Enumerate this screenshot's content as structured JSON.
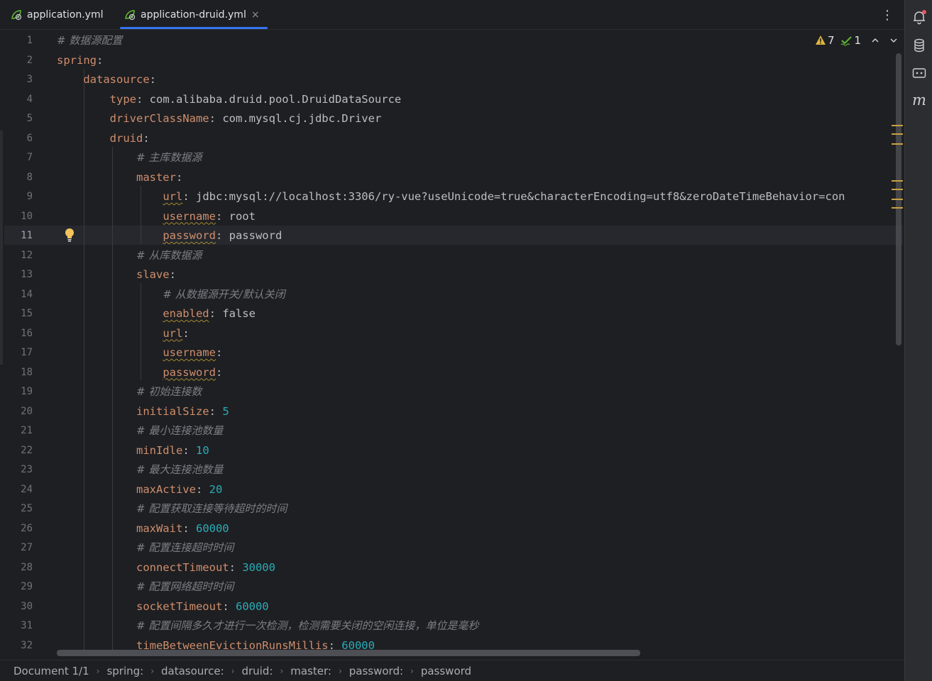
{
  "tabs": [
    {
      "label": "application.yml",
      "active": false
    },
    {
      "label": "application-druid.yml",
      "active": true
    }
  ],
  "tab_close_glyph": "×",
  "more_menu_glyph": "⋮",
  "inspections": {
    "warnings": "7",
    "weak_warnings": "1"
  },
  "right_toolbar_icons": [
    "notifications-icon",
    "database-icon",
    "ai-assistant-icon",
    "maven-icon"
  ],
  "right_toolbar_maven_glyph": "m",
  "current_line": 11,
  "line_numbers": [
    "1",
    "2",
    "3",
    "4",
    "5",
    "6",
    "7",
    "8",
    "9",
    "10",
    "11",
    "12",
    "13",
    "14",
    "15",
    "16",
    "17",
    "18",
    "19",
    "20",
    "21",
    "22",
    "23",
    "24",
    "25",
    "26",
    "27",
    "28",
    "29",
    "30",
    "31",
    "32"
  ],
  "code_lines": [
    [
      {
        "t": "# 数据源配置",
        "c": "c"
      }
    ],
    [
      {
        "t": "spring",
        "c": "k"
      },
      {
        "t": ":",
        "c": "p"
      }
    ],
    [
      {
        "t": "    "
      },
      {
        "t": "datasource",
        "c": "k"
      },
      {
        "t": ":",
        "c": "p"
      }
    ],
    [
      {
        "t": "        "
      },
      {
        "t": "type",
        "c": "k"
      },
      {
        "t": ": ",
        "c": "p"
      },
      {
        "t": "com.alibaba.druid.pool.DruidDataSource",
        "c": "v"
      }
    ],
    [
      {
        "t": "        "
      },
      {
        "t": "driverClassName",
        "c": "k"
      },
      {
        "t": ": ",
        "c": "p"
      },
      {
        "t": "com.mysql.cj.jdbc.Driver",
        "c": "v"
      }
    ],
    [
      {
        "t": "        "
      },
      {
        "t": "druid",
        "c": "k"
      },
      {
        "t": ":",
        "c": "p"
      }
    ],
    [
      {
        "t": "            "
      },
      {
        "t": "# 主库数据源",
        "c": "c"
      }
    ],
    [
      {
        "t": "            "
      },
      {
        "t": "master",
        "c": "k"
      },
      {
        "t": ":",
        "c": "p"
      }
    ],
    [
      {
        "t": "                "
      },
      {
        "t": "url",
        "c": "k w"
      },
      {
        "t": ": ",
        "c": "p"
      },
      {
        "t": "jdbc:mysql://localhost:3306/ry-vue?useUnicode=true&characterEncoding=utf8&zeroDateTimeBehavior=con",
        "c": "v"
      }
    ],
    [
      {
        "t": "                "
      },
      {
        "t": "username",
        "c": "k w"
      },
      {
        "t": ": ",
        "c": "p"
      },
      {
        "t": "root",
        "c": "v"
      }
    ],
    [
      {
        "t": "                "
      },
      {
        "t": "password",
        "c": "k w"
      },
      {
        "t": ": ",
        "c": "p"
      },
      {
        "t": "password",
        "c": "v"
      }
    ],
    [
      {
        "t": "            "
      },
      {
        "t": "# 从库数据源",
        "c": "c"
      }
    ],
    [
      {
        "t": "            "
      },
      {
        "t": "slave",
        "c": "k"
      },
      {
        "t": ":",
        "c": "p"
      }
    ],
    [
      {
        "t": "                "
      },
      {
        "t": "# 从数据源开关/默认关闭",
        "c": "c"
      }
    ],
    [
      {
        "t": "                "
      },
      {
        "t": "enabled",
        "c": "k w"
      },
      {
        "t": ": ",
        "c": "p"
      },
      {
        "t": "false",
        "c": "v"
      }
    ],
    [
      {
        "t": "                "
      },
      {
        "t": "url",
        "c": "k w"
      },
      {
        "t": ":",
        "c": "p"
      }
    ],
    [
      {
        "t": "                "
      },
      {
        "t": "username",
        "c": "k w"
      },
      {
        "t": ":",
        "c": "p"
      }
    ],
    [
      {
        "t": "                "
      },
      {
        "t": "password",
        "c": "k w"
      },
      {
        "t": ":",
        "c": "p"
      }
    ],
    [
      {
        "t": "            "
      },
      {
        "t": "# 初始连接数",
        "c": "c"
      }
    ],
    [
      {
        "t": "            "
      },
      {
        "t": "initialSize",
        "c": "k"
      },
      {
        "t": ": ",
        "c": "p"
      },
      {
        "t": "5",
        "c": "n"
      }
    ],
    [
      {
        "t": "            "
      },
      {
        "t": "# 最小连接池数量",
        "c": "c"
      }
    ],
    [
      {
        "t": "            "
      },
      {
        "t": "minIdle",
        "c": "k"
      },
      {
        "t": ": ",
        "c": "p"
      },
      {
        "t": "10",
        "c": "n"
      }
    ],
    [
      {
        "t": "            "
      },
      {
        "t": "# 最大连接池数量",
        "c": "c"
      }
    ],
    [
      {
        "t": "            "
      },
      {
        "t": "maxActive",
        "c": "k"
      },
      {
        "t": ": ",
        "c": "p"
      },
      {
        "t": "20",
        "c": "n"
      }
    ],
    [
      {
        "t": "            "
      },
      {
        "t": "# 配置获取连接等待超时的时间",
        "c": "c"
      }
    ],
    [
      {
        "t": "            "
      },
      {
        "t": "maxWait",
        "c": "k"
      },
      {
        "t": ": ",
        "c": "p"
      },
      {
        "t": "60000",
        "c": "n"
      }
    ],
    [
      {
        "t": "            "
      },
      {
        "t": "# 配置连接超时时间",
        "c": "c"
      }
    ],
    [
      {
        "t": "            "
      },
      {
        "t": "connectTimeout",
        "c": "k"
      },
      {
        "t": ": ",
        "c": "p"
      },
      {
        "t": "30000",
        "c": "n"
      }
    ],
    [
      {
        "t": "            "
      },
      {
        "t": "# 配置网络超时时间",
        "c": "c"
      }
    ],
    [
      {
        "t": "            "
      },
      {
        "t": "socketTimeout",
        "c": "k"
      },
      {
        "t": ": ",
        "c": "p"
      },
      {
        "t": "60000",
        "c": "n"
      }
    ],
    [
      {
        "t": "            "
      },
      {
        "t": "# 配置间隔多久才进行一次检测，检测需要关闭的空闲连接，单位是毫秒",
        "c": "c"
      }
    ],
    [
      {
        "t": "            "
      },
      {
        "t": "timeBetweenEvictionRunsMillis",
        "c": "k"
      },
      {
        "t": ": ",
        "c": "p"
      },
      {
        "t": "60000",
        "c": "n"
      }
    ]
  ],
  "breadcrumb": [
    "Document 1/1",
    "spring:",
    "datasource:",
    "druid:",
    "master:",
    "password:",
    "password"
  ],
  "breadcrumb_separator": "›",
  "colors": {
    "background": "#1e1f22",
    "key": "#cf8e6d",
    "number": "#2aacb8",
    "comment": "#7a7e85",
    "accent": "#3574f0",
    "warning": "#e0b53d"
  }
}
